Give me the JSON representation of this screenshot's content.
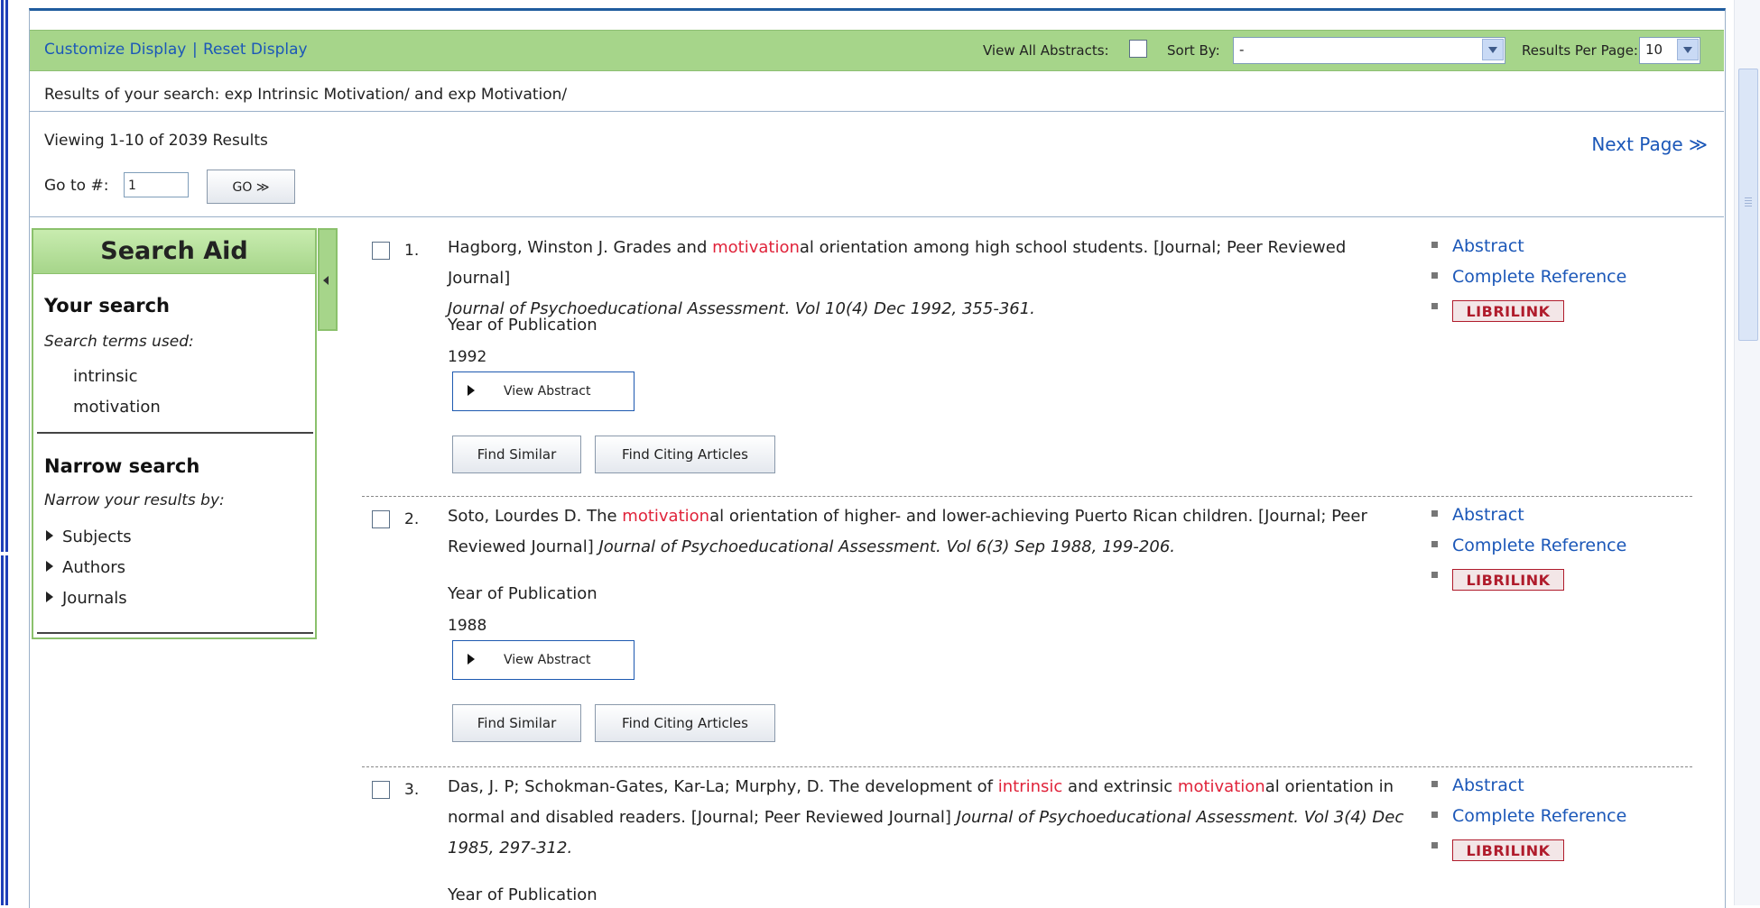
{
  "toolbar": {
    "customize": "Customize Display",
    "separator": "|",
    "reset": "Reset Display",
    "view_all_label": "View All Abstracts:",
    "sort_label": "Sort By:",
    "sort_value": "-",
    "per_page_label": "Results Per Page:",
    "per_page_value": "10"
  },
  "search_summary": "Results of your search: exp Intrinsic Motivation/ and exp Motivation/",
  "viewing": "Viewing 1-10 of 2039 Results",
  "next_page": "Next Page ≫",
  "goto": {
    "label": "Go to #:",
    "value": "1",
    "button": "GO ≫"
  },
  "search_aid": {
    "title": "Search Aid",
    "your_search": "Your search",
    "terms_used": "Search terms used:",
    "terms": [
      "intrinsic",
      "motivation"
    ],
    "narrow": "Narrow search",
    "narrow_by": "Narrow your results by:",
    "facets": [
      "Subjects",
      "Authors",
      "Journals"
    ]
  },
  "year_label": "Year of Publication",
  "view_abstract": "View Abstract",
  "find_similar": "Find Similar",
  "find_citing": "Find Citing Articles",
  "link_labels": {
    "abstract": "Abstract",
    "complete": "Complete Reference",
    "librilink": "LIBRILINK"
  },
  "results": [
    {
      "num": "1.",
      "pre": "Hagborg, Winston J. Grades and ",
      "hl1": "motivation",
      "mid": "al orientation among high school students. [Journal; Peer Reviewed Journal]",
      "journal": "Journal of Psychoeducational Assessment. Vol 10(4) Dec 1992, 355-361.",
      "year": "1992"
    },
    {
      "num": "2.",
      "pre": "Soto, Lourdes D. The ",
      "hl1": "motivation",
      "mid": "al orientation of higher- and lower-achieving Puerto Rican children. [Journal; Peer Reviewed Journal]",
      "journal": "Journal of Psychoeducational Assessment. Vol 6(3) Sep 1988, 199-206.",
      "year": "1988"
    },
    {
      "num": "3.",
      "pre": "Das, J. P; Schokman-Gates, Kar-La; Murphy, D. The development of ",
      "hl0": "intrinsic",
      "pre2": " and extrinsic ",
      "hl1": "motivation",
      "mid": "al orientation in normal and disabled readers. [Journal; Peer Reviewed Journal]",
      "journal": "Journal of Psychoeducational Assessment. Vol 3(4) Dec 1985, 297-312."
    }
  ]
}
